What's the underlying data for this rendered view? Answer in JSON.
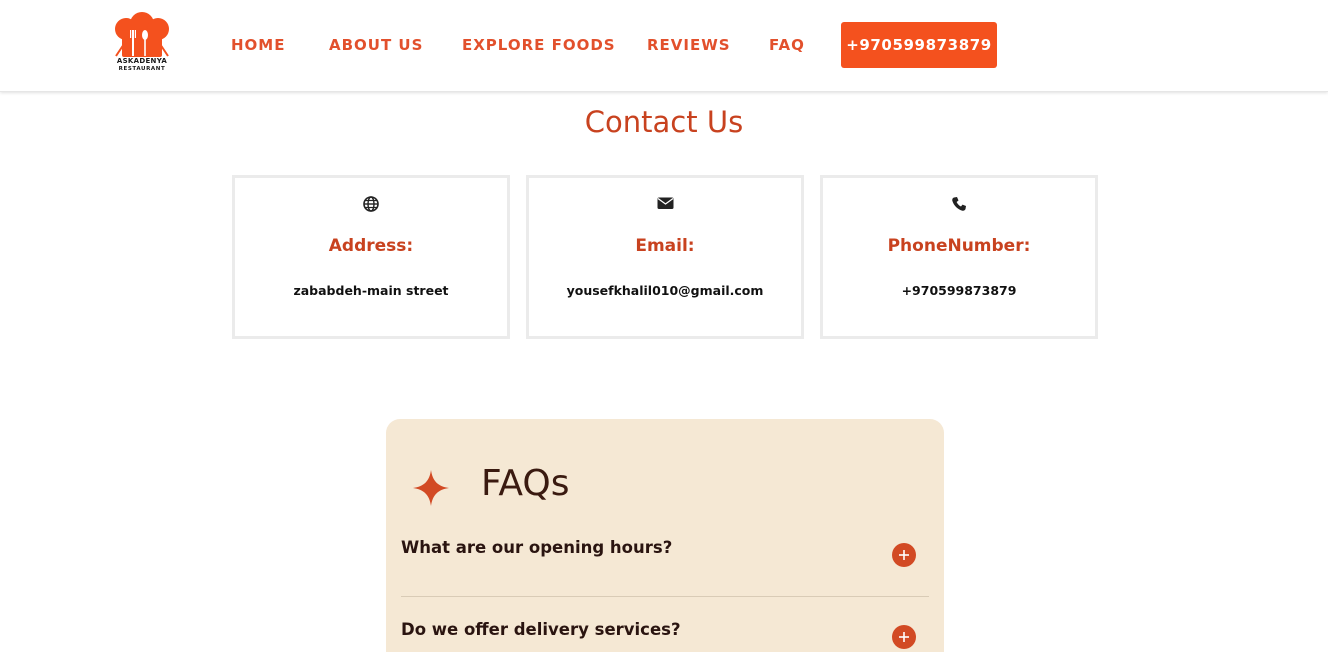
{
  "brand": {
    "name": "ASKADENYA",
    "subtitle": "RESTAURANT",
    "accent_color": "#f4511e",
    "heading_color": "#c8421f"
  },
  "nav": {
    "items": [
      {
        "label": "HOME"
      },
      {
        "label": "ABOUT US"
      },
      {
        "label": "EXPLORE FOODS"
      },
      {
        "label": "REVIEWS"
      },
      {
        "label": "FAQ"
      }
    ],
    "phone_button": "+970599873879"
  },
  "contact": {
    "title": "Contact Us",
    "cards": [
      {
        "icon": "globe-icon",
        "heading": "Address:",
        "value": "zababdeh-main street"
      },
      {
        "icon": "envelope-icon",
        "heading": "Email:",
        "value": "yousefkhalil010@gmail.com"
      },
      {
        "icon": "phone-icon",
        "heading": "PhoneNumber:",
        "value": "+970599873879"
      }
    ]
  },
  "faq": {
    "title": "FAQs",
    "background": "#f5e8d4",
    "questions": [
      {
        "text": "What are our opening hours?"
      },
      {
        "text": "Do we offer delivery services?"
      }
    ]
  }
}
